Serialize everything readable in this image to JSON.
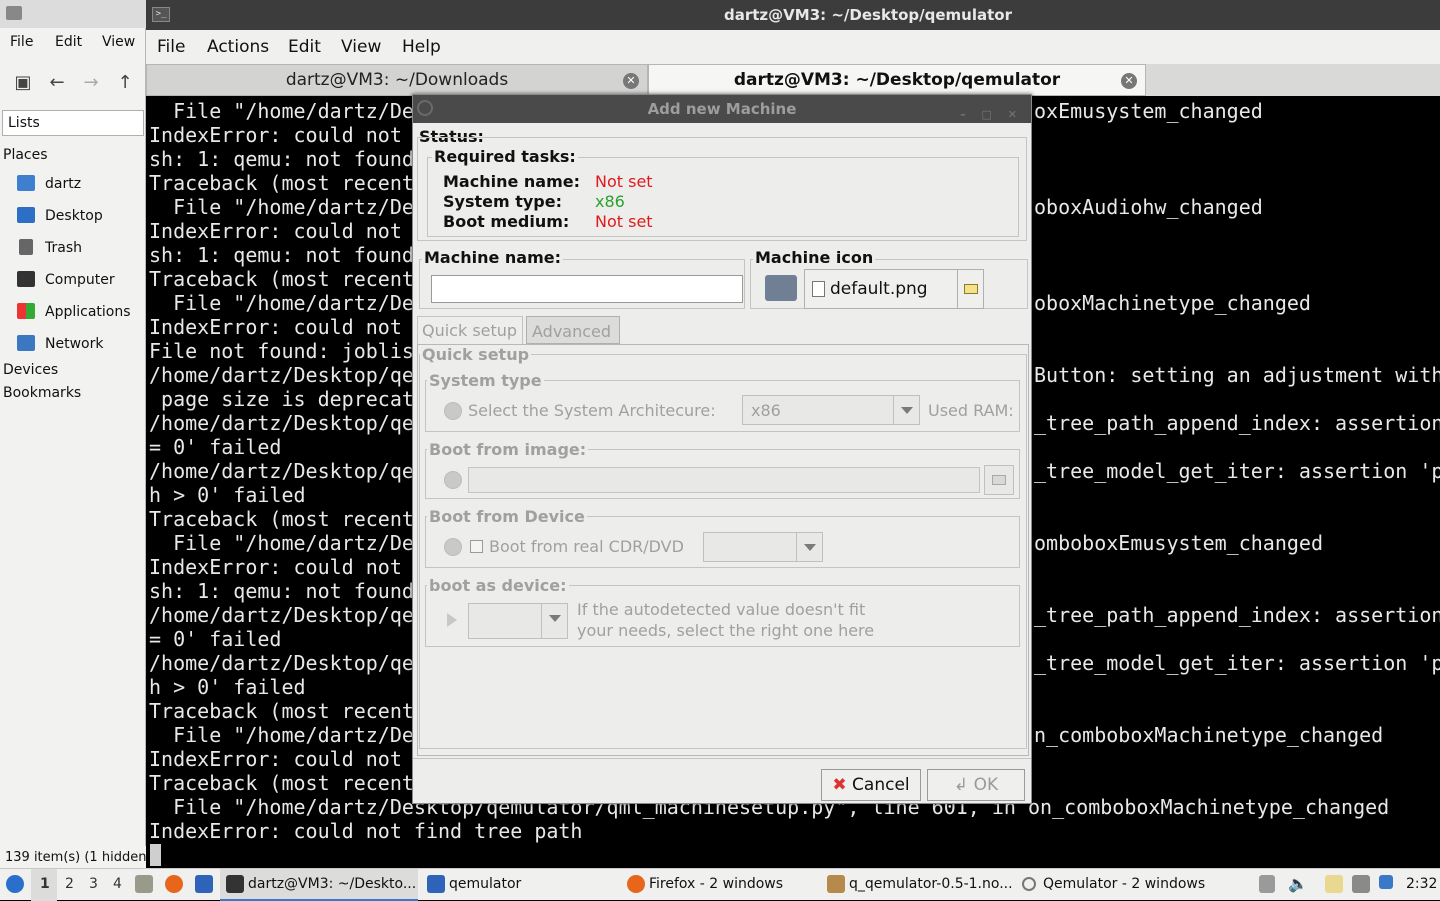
{
  "file_manager": {
    "menu": [
      "File",
      "Edit",
      "View"
    ],
    "lists_label": "Lists",
    "places_header": "Places",
    "places": [
      "dartz",
      "Desktop",
      "Trash",
      "Computer",
      "Applications",
      "Network"
    ],
    "devices_header": "Devices",
    "bookmarks_header": "Bookmarks",
    "status": "139 item(s) (1 hidden"
  },
  "terminal": {
    "title": "dartz@VM3: ~/Desktop/qemulator",
    "menu": [
      "File",
      "Actions",
      "Edit",
      "View",
      "Help"
    ],
    "tabs": [
      {
        "label": "dartz@VM3: ~/Downloads",
        "active": false
      },
      {
        "label": "dartz@VM3: ~/Desktop/qemulator",
        "active": true
      }
    ],
    "left_lines": [
      "  File \"/home/dartz/De",
      "IndexError: could not",
      "sh: 1: qemu: not found",
      "Traceback (most recent",
      "  File \"/home/dartz/De",
      "IndexError: could not",
      "sh: 1: qemu: not found",
      "Traceback (most recent",
      "  File \"/home/dartz/De",
      "IndexError: could not",
      "File not found: joblis",
      "/home/dartz/Desktop/qe",
      " page size is deprecat",
      "/home/dartz/Desktop/qe",
      "= 0' failed",
      "/home/dartz/Desktop/qe",
      "h > 0' failed",
      "Traceback (most recent",
      "  File \"/home/dartz/De",
      "IndexError: could not",
      "sh: 1: qemu: not found",
      "/home/dartz/Desktop/qe",
      "= 0' failed",
      "/home/dartz/Desktop/qe",
      "h > 0' failed",
      "Traceback (most recent",
      "  File \"/home/dartz/De",
      "IndexError: could not",
      "Traceback (most recent",
      "  File \"/home/dartz/Desktop/qemulator/qml_machinesetup.py\", line 601, in on_comboboxMachinetype_changed",
      "IndexError: could not find tree path"
    ],
    "right_lines": [
      {
        "row": 0,
        "text": "oxEmusystem_changed"
      },
      {
        "row": 4,
        "text": "oboxAudiohw_changed"
      },
      {
        "row": 8,
        "text": "oboxMachinetype_changed"
      },
      {
        "row": 11,
        "text": "Button: setting an adjustment with"
      },
      {
        "row": 13,
        "text": "_tree_path_append_index: assertion"
      },
      {
        "row": 15,
        "text": "_tree_model_get_iter: assertion 'p"
      },
      {
        "row": 18,
        "text": "omboboxEmusystem_changed"
      },
      {
        "row": 21,
        "text": "_tree_path_append_index: assertion"
      },
      {
        "row": 23,
        "text": "_tree_model_get_iter: assertion 'p"
      },
      {
        "row": 26,
        "text": "n_comboboxMachinetype_changed"
      }
    ]
  },
  "dialog": {
    "title": "Add new Machine",
    "status_label": "Status:",
    "required_label": "Required tasks:",
    "tasks": [
      {
        "label": "Machine name:",
        "value": "Not set",
        "state": "error"
      },
      {
        "label": "System type:",
        "value": "x86",
        "state": "ok"
      },
      {
        "label": "Boot medium:",
        "value": "Not set",
        "state": "error"
      }
    ],
    "machine_name_label": "Machine name:",
    "machine_name_value": "",
    "machine_icon_label": "Machine icon",
    "icon_file": "default.png",
    "tabs": [
      "Quick setup",
      "Advanced"
    ],
    "quick_setup_header": "Quick setup",
    "system_type_header": "System type",
    "arch_label": "Select the System Architecure:",
    "arch_value": "x86",
    "used_ram_label": "Used RAM:",
    "boot_image_header": "Boot from image:",
    "boot_image_value": "",
    "boot_device_header": "Boot from Device",
    "boot_cdrom_label": "Boot from real CDR/DVD",
    "boot_cdrom_value": "",
    "boot_as_header": "boot as device:",
    "boot_as_value": "",
    "boot_as_hint_1": "If the autodetected value doesn't fit",
    "boot_as_hint_2": "your needs, select the right one here",
    "cancel_label": "Cancel",
    "ok_label": "OK"
  },
  "taskbar": {
    "workspaces": [
      "1",
      "2",
      "3",
      "4"
    ],
    "items": [
      "dartz@VM3: ~/Deskto...",
      "qemulator",
      "Firefox - 2 windows",
      "q_qemulator-0.5-1.no...",
      "Qemulator - 2 windows"
    ],
    "clock": "2:32"
  },
  "colors": {
    "error": "#e01b1b",
    "ok": "#2aa22a",
    "title_bar": "#3c3c3c",
    "terminal_bg": "#000000"
  }
}
